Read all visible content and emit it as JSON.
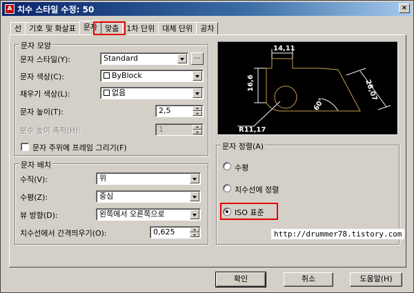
{
  "window": {
    "title": "치수 스타일 수정: 50",
    "icon_letter": "A",
    "close_label": "×"
  },
  "tabs": [
    "선",
    "기호 및 화살표",
    "문자",
    "맞춤",
    "1차 단위",
    "대체 단위",
    "공차"
  ],
  "text_appearance": {
    "title": "문자 모양",
    "style_label": "문자 스타일(Y):",
    "style_value": "Standard",
    "browse_label": "...",
    "color_label": "문자 색상(C):",
    "color_value": "ByBlock",
    "fill_label": "채우기 색상(L):",
    "fill_value": "없음",
    "height_label": "문자 높이(T):",
    "height_value": "2,5",
    "fraction_label": "분수 높이 축척(H):",
    "fraction_value": "1",
    "frame_label": "문자 주위에 프레임 그리기(F)"
  },
  "text_placement": {
    "title": "문자 배치",
    "vertical_label": "수직(V):",
    "vertical_value": "위",
    "horizontal_label": "수평(Z):",
    "horizontal_value": "중심",
    "view_label": "뷰 방향(D):",
    "view_value": "왼쪽에서 오른쪽으로",
    "offset_label": "치수선에서 간격띄우기(O):",
    "offset_value": "0,625"
  },
  "preview": {
    "dim_top": "14,11",
    "dim_left": "16,6",
    "dim_right": "28,07",
    "dim_angle": "60°",
    "dim_radius": "R11,17"
  },
  "text_alignment": {
    "title": "문자 정렬(A)",
    "options": [
      "수평",
      "치수선에 정렬",
      "ISO 표준"
    ],
    "selected": "ISO 표준"
  },
  "watermark": "http://drummer78.tistory.com",
  "buttons": {
    "ok": "확인",
    "cancel": "취소",
    "help": "도움말(H)"
  },
  "colors": {
    "highlight": "#e00000",
    "preview_bg": "#000000",
    "preview_line": "#ffffff",
    "preview_geometry": "#c8a050"
  }
}
